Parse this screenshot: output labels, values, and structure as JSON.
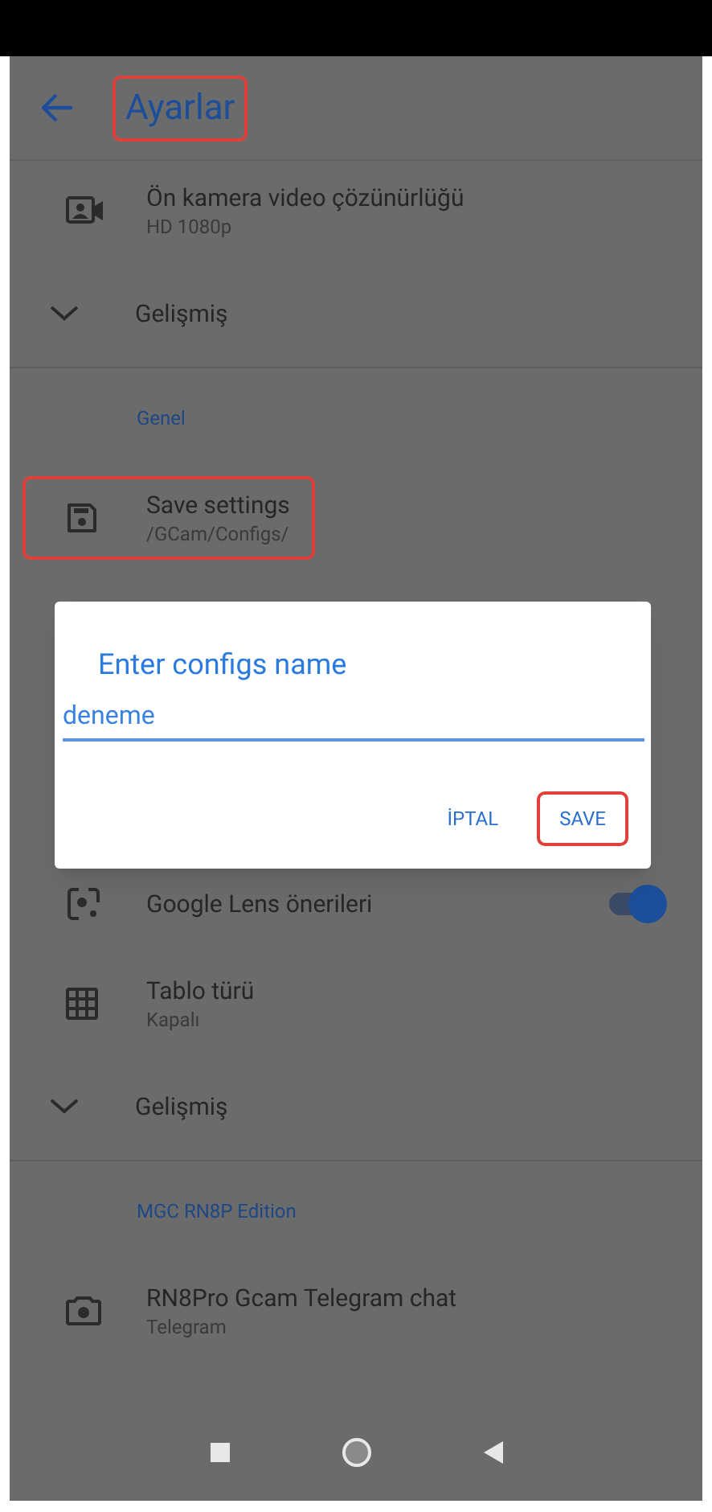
{
  "app_bar": {
    "title": "Ayarlar",
    "highlighted": true
  },
  "items": [
    {
      "kind": "setting",
      "title": "Ön kamera video çözünürlüğü",
      "subtitle": "HD 1080p",
      "highlighted": false
    },
    {
      "kind": "expand",
      "title": "Gelişmiş"
    },
    {
      "kind": "divider"
    },
    {
      "kind": "header",
      "title": "Genel"
    },
    {
      "kind": "setting",
      "title": "Save settings",
      "subtitle": "/GCam/Configs/",
      "highlighted": true
    },
    {
      "kind": "hidden"
    },
    {
      "kind": "switch",
      "title": "Google Lens önerileri",
      "on": true
    },
    {
      "kind": "setting",
      "title": "Tablo türü",
      "subtitle": "Kapalı",
      "highlighted": false
    },
    {
      "kind": "expand",
      "title": "Gelişmiş"
    },
    {
      "kind": "divider"
    },
    {
      "kind": "header",
      "title": "MGC RN8P Edition"
    },
    {
      "kind": "setting",
      "title": "RN8Pro Gcam Telegram chat",
      "subtitle": "Telegram",
      "highlighted": false
    }
  ],
  "dialog": {
    "title": "Enter configs name",
    "value": "deneme",
    "buttons": [
      {
        "label": "İPTAL",
        "highlighted": false
      },
      {
        "label": "SAVE",
        "highlighted": true
      }
    ]
  }
}
